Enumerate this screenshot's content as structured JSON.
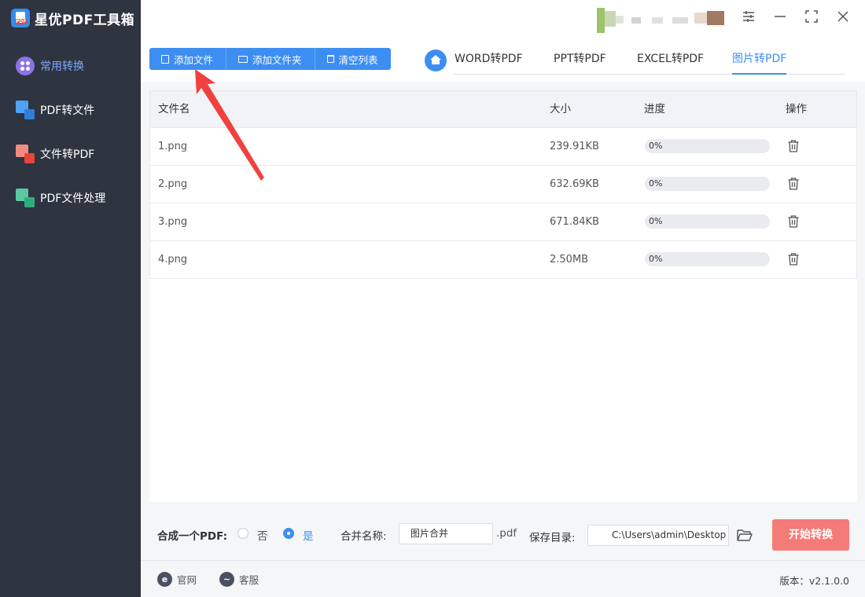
{
  "app": {
    "title": "星优PDF工具箱",
    "version_label": "版本：",
    "version": "v2.1.0.0"
  },
  "sidebar": {
    "items": [
      {
        "label": "常用转换",
        "icon": "grid-dots-icon",
        "active": true
      },
      {
        "label": "PDF转文件",
        "icon": "pdf-to-file-icon"
      },
      {
        "label": "文件转PDF",
        "icon": "file-to-pdf-icon"
      },
      {
        "label": "PDF文件处理",
        "icon": "pdf-process-icon"
      }
    ]
  },
  "toolbar": {
    "add_file": "添加文件",
    "add_folder": "添加文件夹",
    "clear_list": "清空列表"
  },
  "tabs": [
    {
      "label": "WORD转PDF"
    },
    {
      "label": "PPT转PDF"
    },
    {
      "label": "EXCEL转PDF"
    },
    {
      "label": "图片转PDF",
      "active": true
    }
  ],
  "table": {
    "headers": {
      "name": "文件名",
      "size": "大小",
      "progress": "进度",
      "action": "操作"
    },
    "rows": [
      {
        "name": "1.png",
        "size": "239.91KB",
        "progress": "0%",
        "progress_value": 0
      },
      {
        "name": "2.png",
        "size": "632.69KB",
        "progress": "0%",
        "progress_value": 0
      },
      {
        "name": "3.png",
        "size": "671.84KB",
        "progress": "0%",
        "progress_value": 0
      },
      {
        "name": "4.png",
        "size": "2.50MB",
        "progress": "0%",
        "progress_value": 0
      }
    ]
  },
  "settings": {
    "merge_label": "合成一个PDF:",
    "merge_no": "否",
    "merge_yes": "是",
    "merge_selected": "是",
    "merge_name_label": "合并名称:",
    "merge_name_value": "图片合并",
    "merge_ext": ".pdf",
    "save_dir_label": "保存目录:",
    "save_dir_value": "C:\\Users\\admin\\Desktop",
    "start_button": "开始转换"
  },
  "footer": {
    "website": "官网",
    "support": "客服"
  },
  "colors": {
    "accent": "#3d8ef2",
    "sidebar_bg": "#2f3441",
    "start_button": "#f47b77",
    "arrow": "#f0413e"
  }
}
